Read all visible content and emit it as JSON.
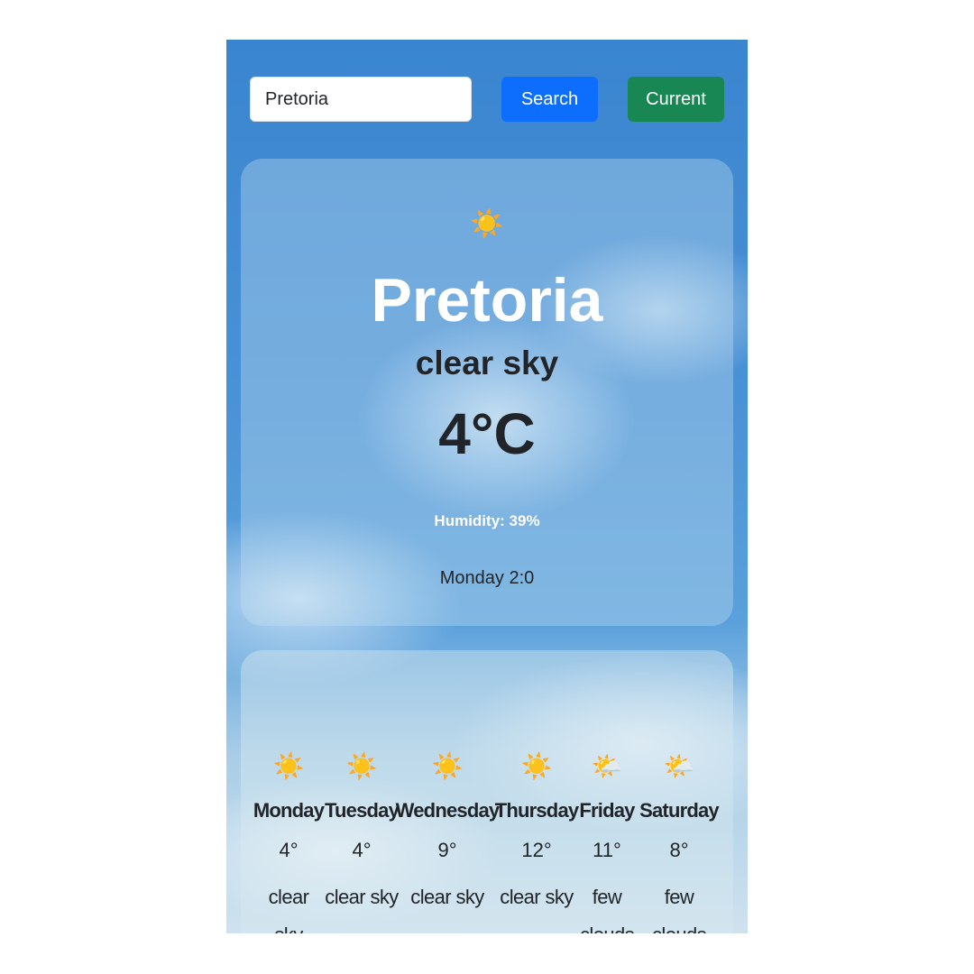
{
  "search": {
    "value": "Pretoria",
    "search_label": "Search",
    "current_label": "Current"
  },
  "colors": {
    "search_button": "#0d6efd",
    "current_button": "#198754"
  },
  "current": {
    "icon": "☀️",
    "icon_name": "sun-icon",
    "city": "Pretoria",
    "description": "clear sky",
    "temperature": "4°C",
    "humidity": "Humidity: 39%",
    "datetime": "Monday 2:0"
  },
  "forecast": [
    {
      "day": "Monday",
      "icon": "☀️",
      "temp": "4°",
      "desc": "clear sky"
    },
    {
      "day": "Tuesday",
      "icon": "☀️",
      "temp": "4°",
      "desc": "clear sky"
    },
    {
      "day": "Wednesday",
      "icon": "☀️",
      "temp": "9°",
      "desc": "clear sky"
    },
    {
      "day": "Thursday",
      "icon": "☀️",
      "temp": "12°",
      "desc": "clear sky"
    },
    {
      "day": "Friday",
      "icon": "🌤️",
      "temp": "11°",
      "desc": "few clouds"
    },
    {
      "day": "Saturday",
      "icon": "🌤️",
      "temp": "8°",
      "desc": "few clouds"
    }
  ]
}
